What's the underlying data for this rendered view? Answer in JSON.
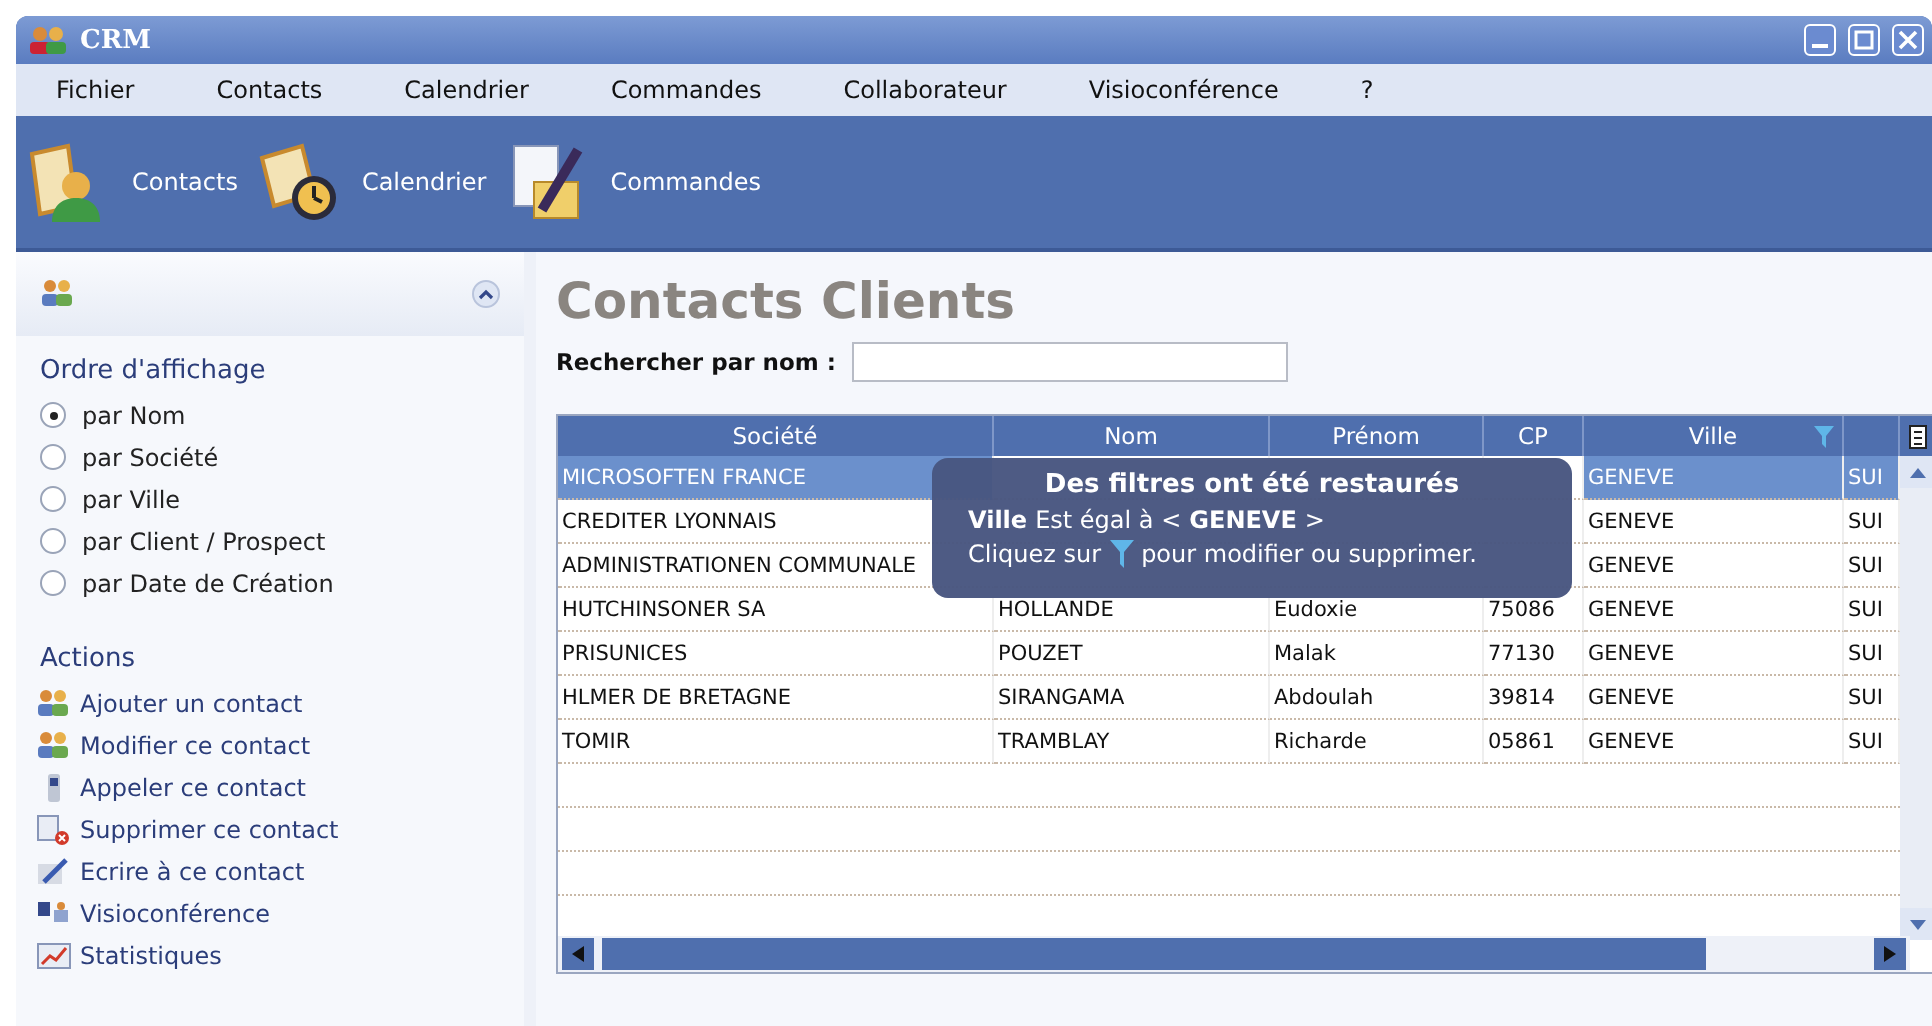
{
  "window": {
    "title": "CRM"
  },
  "menu": [
    "Fichier",
    "Contacts",
    "Calendrier",
    "Commandes",
    "Collaborateur",
    "Visioconférence",
    "?"
  ],
  "toolbar": [
    {
      "label": "Contacts",
      "kind": "contacts"
    },
    {
      "label": "Calendrier",
      "kind": "calendar"
    },
    {
      "label": "Commandes",
      "kind": "orders"
    }
  ],
  "sidebar": {
    "order_title": "Ordre d'affichage",
    "order_options": [
      {
        "label": "par Nom",
        "selected": true
      },
      {
        "label": "par Société",
        "selected": false
      },
      {
        "label": "par Ville",
        "selected": false
      },
      {
        "label": "par Client / Prospect",
        "selected": false
      },
      {
        "label": "par Date de Création",
        "selected": false
      }
    ],
    "actions_title": "Actions",
    "actions": [
      {
        "label": "Ajouter un contact",
        "kind": "people"
      },
      {
        "label": "Modifier ce contact",
        "kind": "people"
      },
      {
        "label": "Appeler ce contact",
        "kind": "phone"
      },
      {
        "label": "Supprimer ce contact",
        "kind": "delete"
      },
      {
        "label": "Ecrire à ce contact",
        "kind": "write"
      },
      {
        "label": "Visioconférence",
        "kind": "video"
      },
      {
        "label": "Statistiques",
        "kind": "chart"
      }
    ]
  },
  "page": {
    "title": "Contacts Clients",
    "search": {
      "label": "Rechercher par nom :"
    }
  },
  "table": {
    "columns": [
      {
        "label": "Société",
        "filtered": false
      },
      {
        "label": "Nom",
        "filtered": false
      },
      {
        "label": "Prénom",
        "filtered": false
      },
      {
        "label": "CP",
        "filtered": false
      },
      {
        "label": "Ville",
        "filtered": true
      },
      {
        "filtered": false
      }
    ],
    "rows": [
      {
        "selected": true,
        "cells": [
          "MICROSOFTEN FRANCE",
          null,
          null,
          null,
          "GENEVE",
          "SUI"
        ]
      },
      {
        "selected": false,
        "cells": [
          "CREDITER LYONNAIS",
          null,
          null,
          null,
          "GENEVE",
          "SUI"
        ]
      },
      {
        "selected": false,
        "cells": [
          "ADMINISTRATIONEN COMMUNALE",
          null,
          null,
          null,
          "GENEVE",
          "SUI"
        ]
      },
      {
        "selected": false,
        "cells": [
          "HUTCHINSONER SA",
          "HOLLANDE",
          "Eudoxie",
          "75086",
          "GENEVE",
          "SUI"
        ]
      },
      {
        "selected": false,
        "cells": [
          "PRISUNICES",
          "POUZET",
          "Malak",
          "77130",
          "GENEVE",
          "SUI"
        ]
      },
      {
        "selected": false,
        "cells": [
          "HLMER DE BRETAGNE",
          "SIRANGAMA",
          "Abdoulah",
          "39814",
          "GENEVE",
          "SUI"
        ]
      },
      {
        "selected": false,
        "cells": [
          "TOMIR",
          "TRAMBLAY",
          "Richarde",
          "05861",
          "GENEVE",
          "SUI"
        ]
      }
    ]
  },
  "filter_tooltip": {
    "title": "Des filtres ont été restaurés",
    "condition": "**Ville** Est égal à <**GENEVE**>",
    "hint_before": "Cliquez sur",
    "hint_after": "pour modifier ou supprimer."
  }
}
